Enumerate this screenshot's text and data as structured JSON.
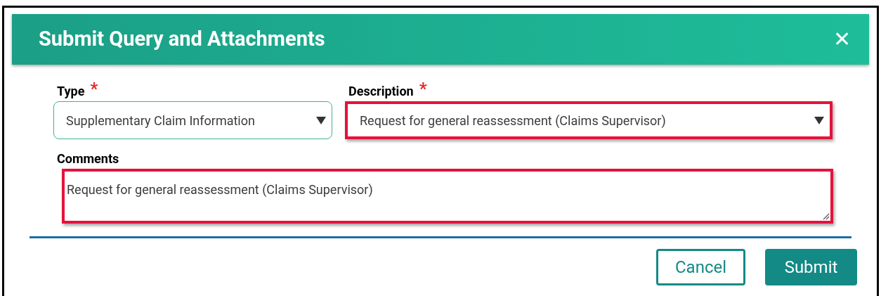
{
  "dialog": {
    "title": "Submit Query and Attachments",
    "close": "✕"
  },
  "fields": [
    {
      "kind": "select",
      "label": "Type",
      "required_mark": "*",
      "value": "Supplementary Claim Information",
      "highlighted": false
    },
    {
      "kind": "select",
      "label": "Description",
      "required_mark": "*",
      "value": "Request for general reassessment (Claims Supervisor)",
      "highlighted": true
    },
    {
      "kind": "textarea",
      "label": "Comments",
      "value": "Request for general reassessment (Claims Supervisor)",
      "highlighted": true
    }
  ],
  "buttons": [
    {
      "label": "Cancel",
      "kind": "secondary"
    },
    {
      "label": "Submit",
      "kind": "primary"
    }
  ]
}
